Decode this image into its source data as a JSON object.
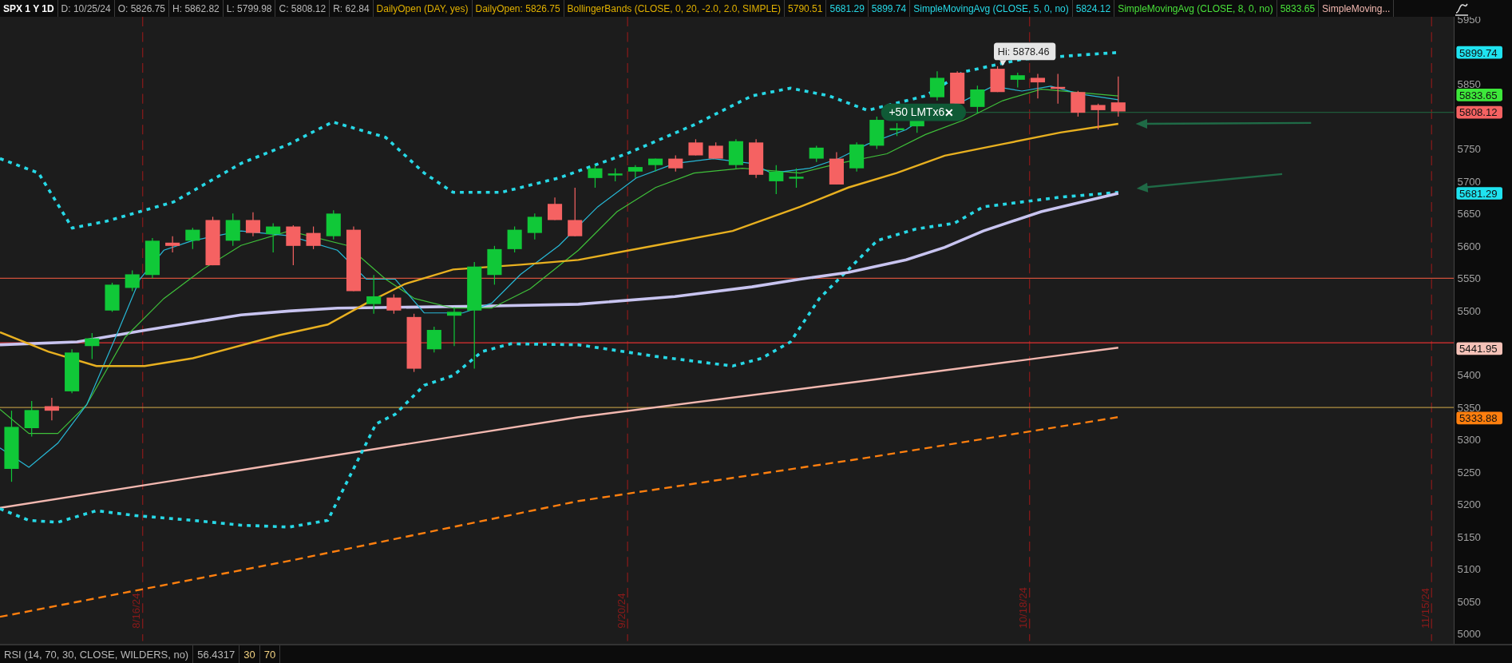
{
  "header": {
    "items": [
      {
        "text": "SPX 1 Y 1D",
        "color": "#ffffff",
        "kind": "symbol"
      },
      {
        "text": "D: 10/25/24",
        "color": "#b8b8b8",
        "kind": "field"
      },
      {
        "text": "O: 5826.75",
        "color": "#b8b8b8",
        "kind": "field"
      },
      {
        "text": "H: 5862.82",
        "color": "#b8b8b8",
        "kind": "field"
      },
      {
        "text": "L: 5799.98",
        "color": "#b8b8b8",
        "kind": "field"
      },
      {
        "text": "C: 5808.12",
        "color": "#b8b8b8",
        "kind": "field"
      },
      {
        "text": "R: 62.84",
        "color": "#b8b8b8",
        "kind": "field"
      },
      {
        "text": "DailyOpen (DAY, yes)",
        "color": "#e0b000",
        "kind": "study"
      },
      {
        "text": "DailyOpen: 5826.75",
        "color": "#e0b000",
        "kind": "study"
      },
      {
        "text": "BollingerBands (CLOSE, 0, 20, -2.0, 2.0, SIMPLE)",
        "color": "#e0b000",
        "kind": "study"
      },
      {
        "text": "5790.51",
        "color": "#e0b000",
        "kind": "value"
      },
      {
        "text": "5681.29",
        "color": "#27d8e6",
        "kind": "value"
      },
      {
        "text": "5899.74",
        "color": "#27d8e6",
        "kind": "value"
      },
      {
        "text": "SimpleMovingAvg (CLOSE, 5, 0, no)",
        "color": "#27d8e6",
        "kind": "study"
      },
      {
        "text": "5824.12",
        "color": "#27d8e6",
        "kind": "value"
      },
      {
        "text": "SimpleMovingAvg (CLOSE, 8, 0, no)",
        "color": "#49e03a",
        "kind": "study"
      },
      {
        "text": "5833.65",
        "color": "#49e03a",
        "kind": "value"
      },
      {
        "text": "SimpleMoving...",
        "color": "#f2b8b0",
        "kind": "study"
      }
    ]
  },
  "y_axis": {
    "ticks": [
      "5950",
      "5850",
      "5750",
      "5700",
      "5650",
      "5600",
      "5550",
      "5500",
      "5400",
      "5350",
      "5300",
      "5250",
      "5200",
      "5150",
      "5100",
      "5050",
      "5000"
    ],
    "price_tags": [
      {
        "text": "5899.74",
        "color": "#1fe3f0"
      },
      {
        "text": "5833.65",
        "color": "#3de83a"
      },
      {
        "text": "5808.12",
        "color": "#f56262"
      },
      {
        "text": "5681.29",
        "color": "#1fe3f0"
      },
      {
        "text": "5441.95",
        "color": "#f5c2b8"
      },
      {
        "text": "5333.88",
        "color": "#ff7f0e"
      }
    ]
  },
  "date_labels": [
    "8/16/24",
    "9/20/24",
    "10/18/24",
    "11/15/24"
  ],
  "order_tag": {
    "label": "+50 LMTx6",
    "close": "✕"
  },
  "high_callout": "Hi: 5878.46",
  "rsi_bar": [
    {
      "text": "RSI (14, 70, 30, CLOSE, WILDERS, no)",
      "color": "#b8b8b8"
    },
    {
      "text": "56.4317",
      "color": "#b8b8b8"
    },
    {
      "text": "30",
      "color": "#f0d080"
    },
    {
      "text": "70",
      "color": "#f0d080"
    }
  ]
}
